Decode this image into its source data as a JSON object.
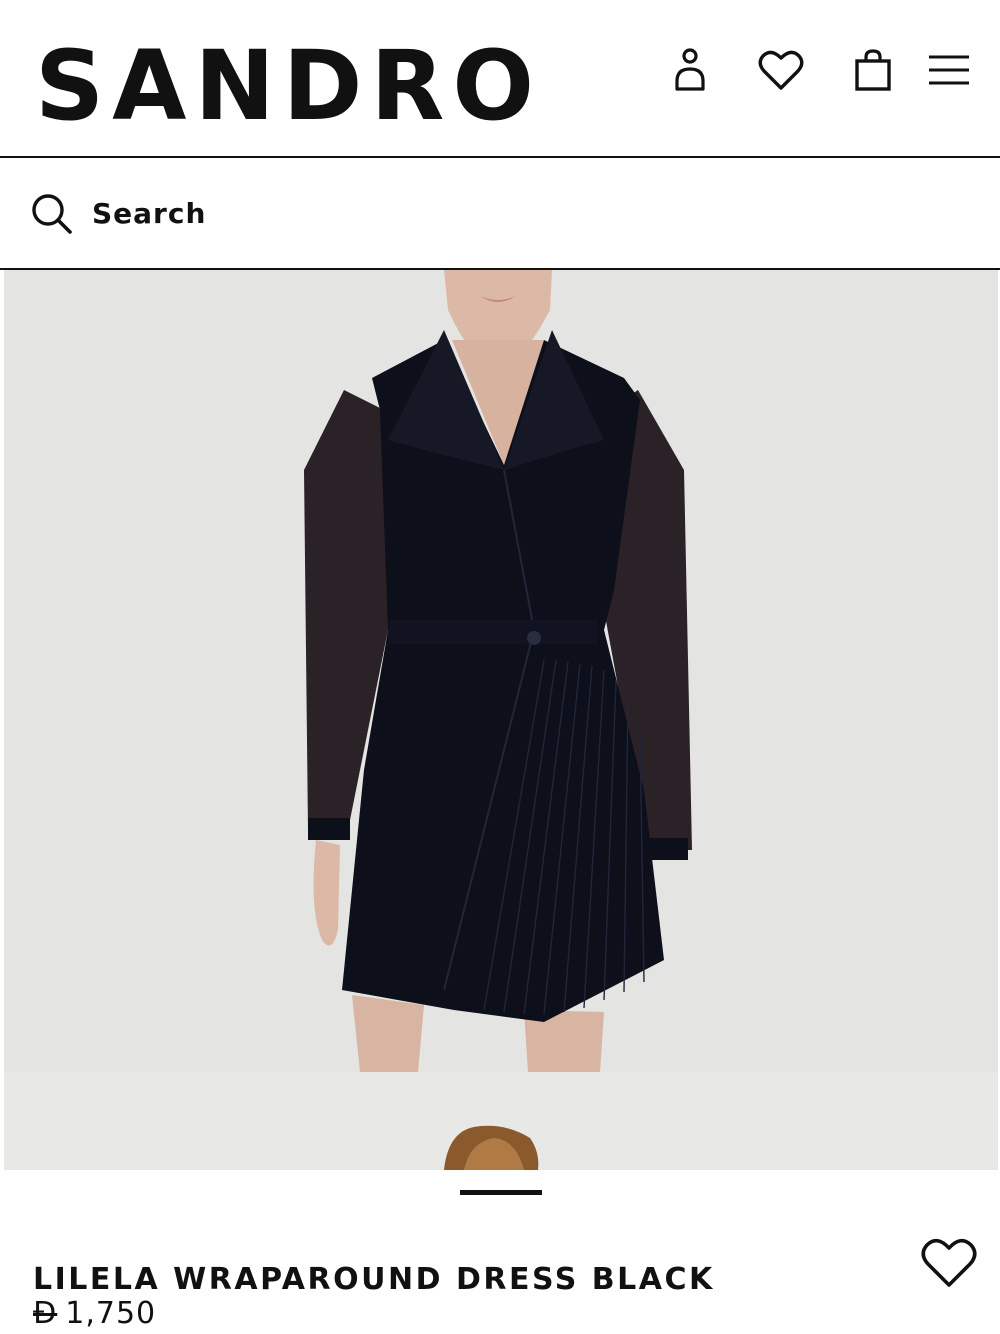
{
  "header": {
    "brand": "SANDRO",
    "icons": [
      "account-icon",
      "wishlist-icon",
      "bag-icon",
      "menu-icon"
    ]
  },
  "search": {
    "placeholder": "Search"
  },
  "gallery": {
    "images": [
      "black wrap dress front view",
      "next product image"
    ],
    "current_index": 1,
    "count": 2
  },
  "product": {
    "title": "LILELA WRAPAROUND DRESS BLACK",
    "currency": "Đ",
    "price": "1,750"
  },
  "colors": {
    "text": "#111111",
    "gallery_bg": "#e4e4e2",
    "dress": "#0d0f1a"
  }
}
